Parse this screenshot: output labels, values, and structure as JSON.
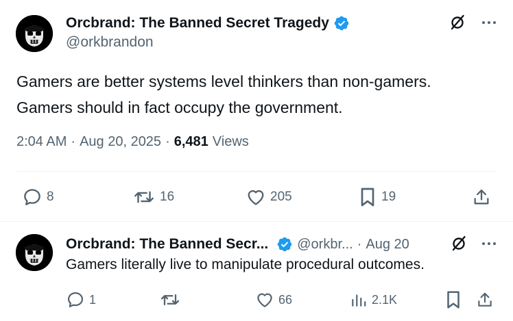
{
  "main_tweet": {
    "author": {
      "display_name": "Orcbrand: The Banned Secret Tragedy",
      "handle": "@orkbrandon",
      "verified": true,
      "verified_color": "#1d9bf0"
    },
    "text_lines": [
      "Gamers are better systems level thinkers than non-gamers.",
      "Gamers should in fact occupy the government."
    ],
    "time": "2:04 AM",
    "separator": "·",
    "date": "Aug 20, 2025",
    "views_count": "6,481",
    "views_label": "Views",
    "actions": {
      "replies": "8",
      "reposts": "16",
      "likes": "205",
      "bookmarks": "19"
    }
  },
  "reply_tweet": {
    "author": {
      "display_name": "Orcbrand: The Banned Secr...",
      "handle": "@orkbr...",
      "verified": true
    },
    "separator": "·",
    "date": "Aug 20",
    "text": "Gamers literally live to manipulate procedural outcomes.",
    "actions": {
      "replies": "1",
      "reposts": "",
      "likes": "66",
      "views": "2.1K"
    }
  },
  "icons": {
    "grok": "grok-slash-icon",
    "more": "more-dots-icon",
    "reply": "reply-bubble-icon",
    "repost": "repost-arrows-icon",
    "like": "heart-icon",
    "bookmark": "bookmark-icon",
    "share": "share-upload-icon",
    "views": "analytics-bars-icon"
  },
  "colors": {
    "text_primary": "#0f1419",
    "text_secondary": "#536471",
    "verified_blue": "#1d9bf0",
    "divider": "#eff3f4"
  }
}
